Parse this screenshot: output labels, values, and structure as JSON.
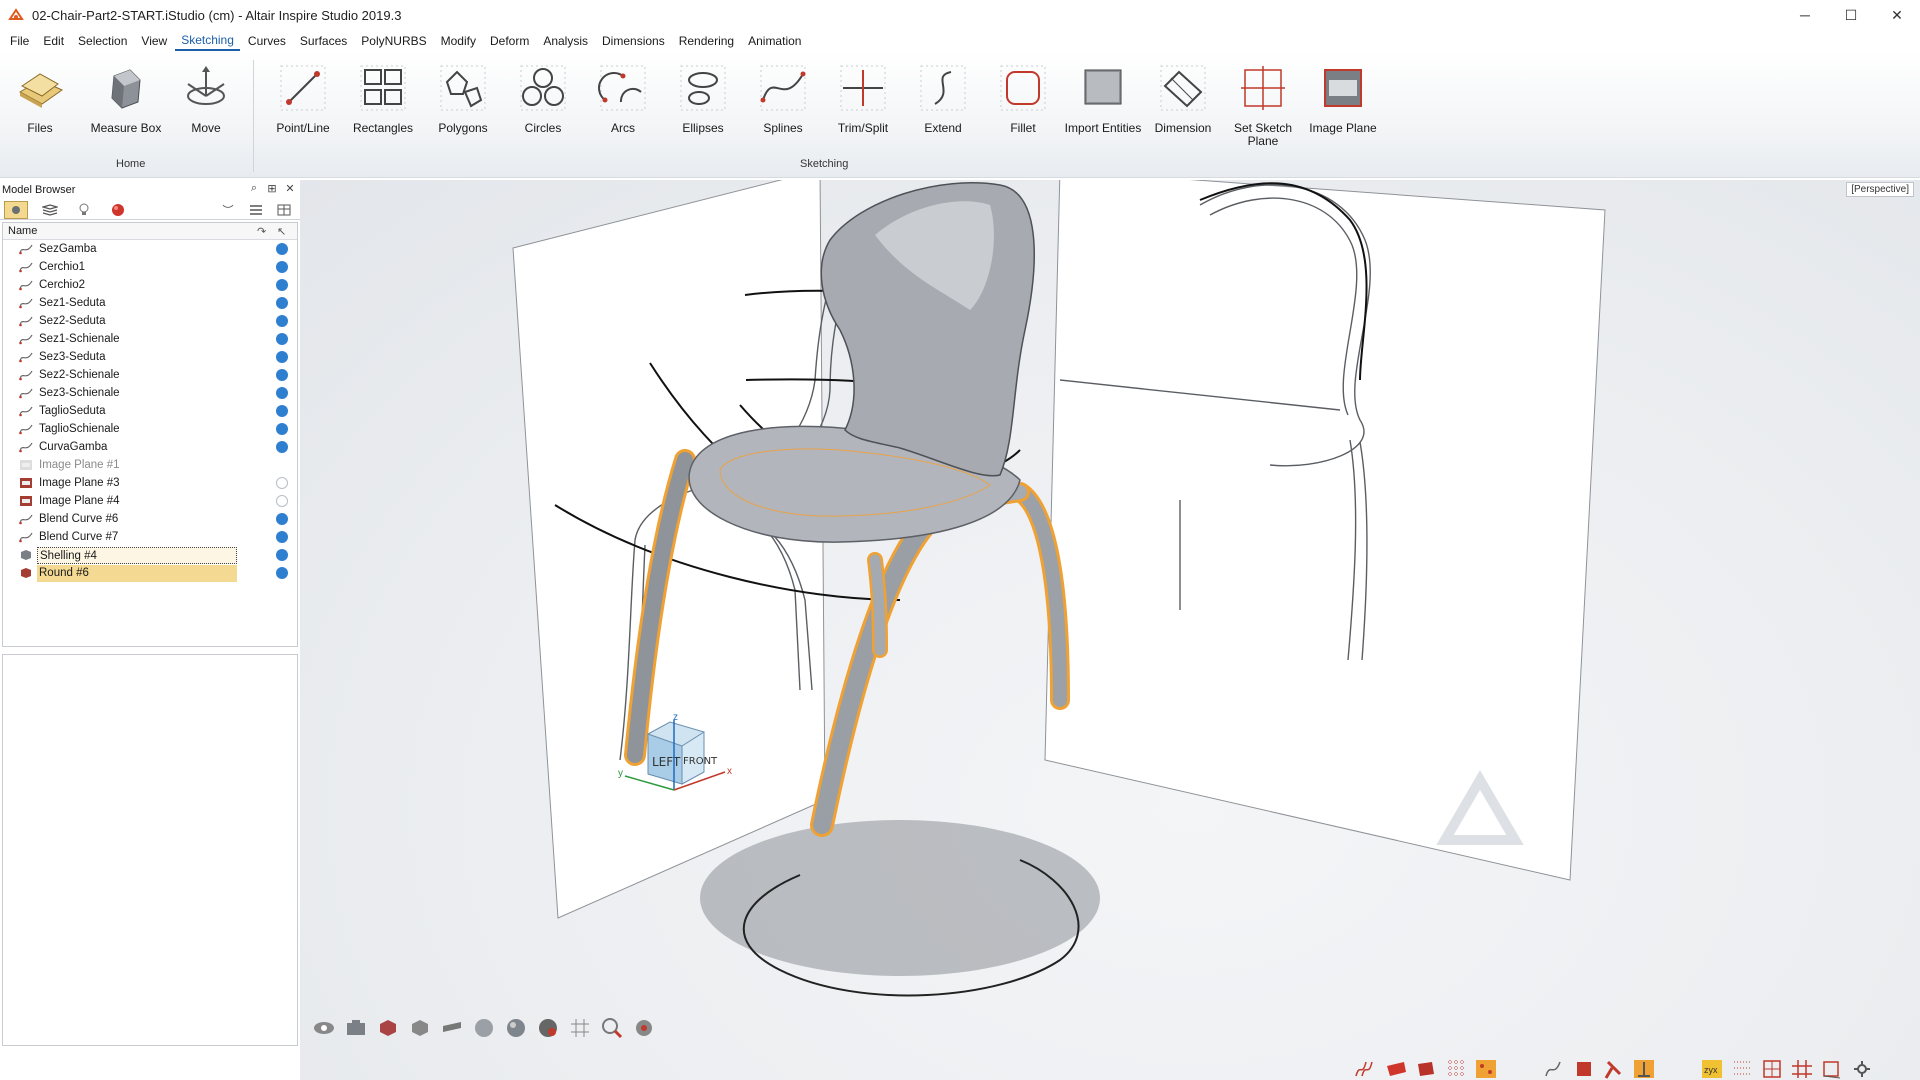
{
  "window": {
    "title": "02-Chair-Part2-START.iStudio (cm) - Altair Inspire Studio 2019.3",
    "minimize": "─",
    "maximize": "☐",
    "close": "✕"
  },
  "menu": {
    "items": [
      "File",
      "Edit",
      "Selection",
      "View",
      "Sketching",
      "Curves",
      "Surfaces",
      "PolyNURBS",
      "Modify",
      "Deform",
      "Analysis",
      "Dimensions",
      "Rendering",
      "Animation"
    ],
    "active": "Sketching"
  },
  "ribbon": {
    "home_tools": [
      {
        "label": "Files",
        "icon": "files-icon"
      },
      {
        "label": "Measure Box",
        "icon": "measure-box-icon"
      },
      {
        "label": "Move",
        "icon": "move-icon"
      }
    ],
    "home_group": "Home",
    "sketch_tools": [
      {
        "label": "Point/Line",
        "icon": "point-line-icon"
      },
      {
        "label": "Rectangles",
        "icon": "rectangles-icon"
      },
      {
        "label": "Polygons",
        "icon": "polygons-icon"
      },
      {
        "label": "Circles",
        "icon": "circles-icon"
      },
      {
        "label": "Arcs",
        "icon": "arcs-icon"
      },
      {
        "label": "Ellipses",
        "icon": "ellipses-icon"
      },
      {
        "label": "Splines",
        "icon": "splines-icon"
      },
      {
        "label": "Trim/Split",
        "icon": "trim-split-icon"
      },
      {
        "label": "Extend",
        "icon": "extend-icon"
      },
      {
        "label": "Fillet",
        "icon": "fillet-icon"
      },
      {
        "label": "Import Entities",
        "icon": "import-entities-icon"
      },
      {
        "label": "Dimension",
        "icon": "dimension-icon"
      },
      {
        "label": "Set Sketch Plane",
        "icon": "set-sketch-plane-icon"
      },
      {
        "label": "Image Plane",
        "icon": "image-plane-icon"
      }
    ],
    "sketch_group": "Sketching"
  },
  "model_browser": {
    "title": "Model Browser",
    "column_name": "Name",
    "items": [
      {
        "name": "SezGamba",
        "type": "curve",
        "visible": true
      },
      {
        "name": "Cerchio1",
        "type": "curve",
        "visible": true
      },
      {
        "name": "Cerchio2",
        "type": "curve",
        "visible": true
      },
      {
        "name": "Sez1-Seduta",
        "type": "curve",
        "visible": true
      },
      {
        "name": "Sez2-Seduta",
        "type": "curve",
        "visible": true
      },
      {
        "name": "Sez1-Schienale",
        "type": "curve",
        "visible": true
      },
      {
        "name": "Sez3-Seduta",
        "type": "curve",
        "visible": true
      },
      {
        "name": "Sez2-Schienale",
        "type": "curve",
        "visible": true
      },
      {
        "name": "Sez3-Schienale",
        "type": "curve",
        "visible": true
      },
      {
        "name": "TaglioSeduta",
        "type": "curve",
        "visible": true
      },
      {
        "name": "TaglioSchienale",
        "type": "curve",
        "visible": true
      },
      {
        "name": "CurvaGamba",
        "type": "curve",
        "visible": true
      },
      {
        "name": "Image Plane #1",
        "type": "image",
        "visible": null
      },
      {
        "name": "Image Plane #3",
        "type": "image",
        "visible": false
      },
      {
        "name": "Image Plane #4",
        "type": "image",
        "visible": false
      },
      {
        "name": "Blend Curve #6",
        "type": "curve",
        "visible": true
      },
      {
        "name": "Blend Curve #7",
        "type": "curve",
        "visible": true
      },
      {
        "name": "Shelling #4",
        "type": "solid",
        "visible": true
      },
      {
        "name": "Round #6",
        "type": "solid",
        "visible": true
      }
    ]
  },
  "viewport": {
    "view_mode": "[Perspective]",
    "view_cube": {
      "left": "LEFT",
      "front": "FRONT",
      "axis_x": "x",
      "axis_y": "y",
      "axis_z": "z"
    }
  },
  "colors": {
    "accent": "#1b5fa8",
    "selection": "#f3d992",
    "highlight_edge": "#f5a623",
    "visible_check": "#2f7fd1"
  }
}
